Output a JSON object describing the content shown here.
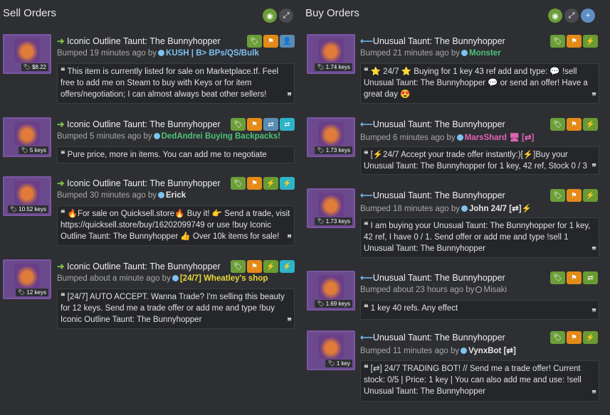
{
  "sell": {
    "title": "Sell Orders",
    "orders": [
      {
        "name": "Iconic Outline Taunt: The Bunnyhopper",
        "price": "$8.22",
        "bumped": "Bumped 19 minutes ago by",
        "user": "KUSH | B> BPs/QS/Bulk",
        "comment": "This item is currently listed for sale on Marketplace.tf. Feel free to add me on Steam to buy with Keys or for item offers/negotiation; I can almost always beat other sellers!"
      },
      {
        "name": "Iconic Outline Taunt: The Bunnyhopper",
        "price": "5 keys",
        "bumped": "Bumped 5 minutes ago by",
        "user": "DedAndrei Buying Backpacks!",
        "comment": "Pure price, more in items. You can add me to negotiate"
      },
      {
        "name": "Iconic Outline Taunt: The Bunnyhopper",
        "price": "10.52 keys",
        "bumped": "Bumped 30 minutes ago by",
        "user": "Erick",
        "comment": "🔥For sale on Quicksell.store🔥 Buy it! 👉 Send a trade, visit https://quicksell.store/buy/16202099749 or use !buy Iconic Outline Taunt: The Bunnyhopper 👍 Over 10k items for sale!"
      },
      {
        "name": "Iconic Outline Taunt: The Bunnyhopper",
        "price": "12 keys",
        "bumped": "Bumped about a minute ago by",
        "user": "[24/7] Wheatley's shop",
        "comment": "[24/7] AUTO ACCEPT. Wanna Trade? I'm selling this beauty for 12 keys. Send me a trade offer or add me and type !buy Iconic Outline Taunt: The Bunnyhopper"
      }
    ]
  },
  "buy": {
    "title": "Buy Orders",
    "orders": [
      {
        "name": "Unusual Taunt: The Bunnyhopper",
        "price": "1.74 keys",
        "bumped": "Bumped 21 minutes ago by",
        "user": "Monster",
        "comment": "⭐ 24/7 ⭐ Buying for 1 key 43 ref add and type: 💬 !sell Unusual Taunt: The Bunnyhopper 💬 or send an offer! Have a great day 😍"
      },
      {
        "name": "Unusual Taunt: The Bunnyhopper",
        "price": "1.73 keys",
        "bumped": "Bumped 6 minutes ago by",
        "user": "MarsShard 🖥 [⇄]",
        "comment": "[⚡24/7 Accept your trade offer instantly:)[⚡]Buy your Unusual Taunt: The Bunnyhopper for 1 key, 42 ref, Stock 0 / 3"
      },
      {
        "name": "Unusual Taunt: The Bunnyhopper",
        "price": "1.73 keys",
        "bumped": "Bumped 18 minutes ago by",
        "user": "John 24/7 [⇄]⚡",
        "comment": "I am buying your Unusual Taunt: The Bunnyhopper for 1 key, 42 ref, I have 0 / 1. Send offer or add me and type !sell 1 Unusual Taunt: The Bunnyhopper"
      },
      {
        "name": "Unusual Taunt: The Bunnyhopper",
        "price": "1.69 keys",
        "bumped": "Bumped about 23 hours ago by",
        "user": "Misaki",
        "comment": "1 key 40 refs. Any effect"
      },
      {
        "name": "Unusual Taunt: The Bunnyhopper",
        "price": "1 key",
        "bumped": "Bumped 11 minutes ago by",
        "user": "VynxBot [⇄]",
        "comment": "[⇄] 24/7 TRADING BOT! // Send me a trade offer! Current stock: 0/5 | Price: 1 key | You can also add me and use: !sell Unusual Taunt: The Bunnyhopper"
      }
    ]
  },
  "glyphs": {
    "quote_open": "❝",
    "quote_close": "❞",
    "arrow_sell": "➜",
    "arrow_buy": "⟵"
  },
  "colors": {
    "background": "#2e2f33",
    "thumb": "#6a4a8c",
    "badge_green": "#6b9e3a",
    "badge_orange": "#e38a18"
  }
}
